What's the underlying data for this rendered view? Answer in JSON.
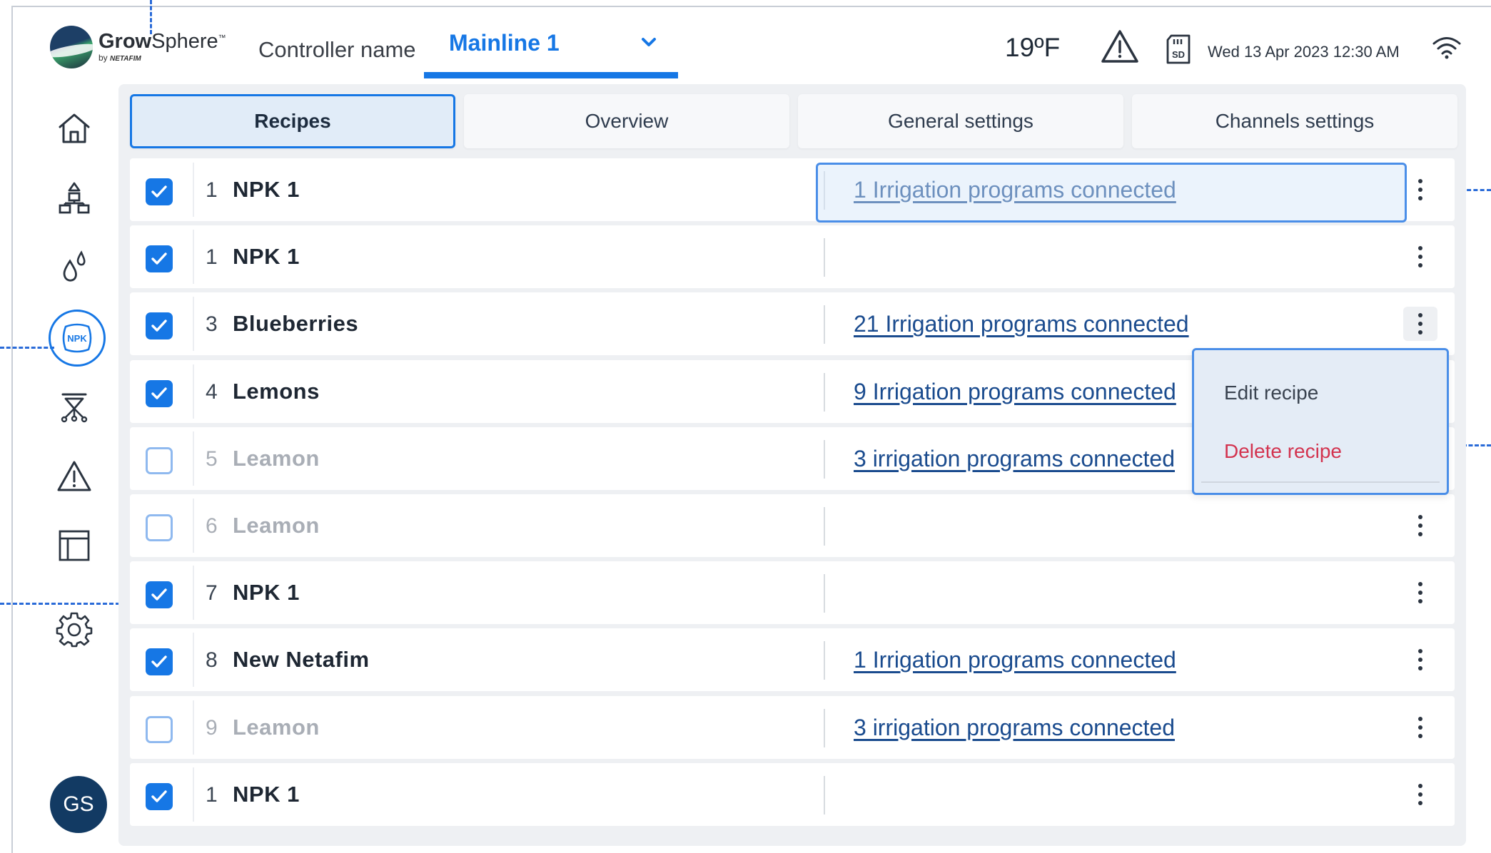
{
  "header": {
    "logo": {
      "brand_bold": "Grow",
      "brand_light": "Sphere",
      "tm": "™",
      "by": "by",
      "maker": "NETAFIM"
    },
    "controller_label": "Controller name",
    "controller_value": "Mainline 1",
    "temperature": "19ºF",
    "datetime": "Wed 13 Apr 2023   12:30 AM",
    "icons": [
      "alert-triangle-icon",
      "sd-card-icon",
      "wifi-icon"
    ]
  },
  "sidebar": {
    "items": [
      {
        "name": "home-icon"
      },
      {
        "name": "hierarchy-icon"
      },
      {
        "name": "water-drops-icon"
      },
      {
        "name": "npk-icon",
        "label": "NPK",
        "active": true
      },
      {
        "name": "sprinkler-icon"
      },
      {
        "name": "alert-icon"
      },
      {
        "name": "table-icon"
      },
      {
        "name": "settings-icon"
      }
    ],
    "avatar_initials": "GS"
  },
  "tabs": [
    {
      "label": "Recipes",
      "active": true
    },
    {
      "label": "Overview",
      "active": false
    },
    {
      "label": "General settings",
      "active": false
    },
    {
      "label": "Channels settings",
      "active": false
    }
  ],
  "rows": [
    {
      "checked": true,
      "num": "1",
      "name": "NPK 1",
      "link": "1 Irrigation programs connected"
    },
    {
      "checked": true,
      "num": "1",
      "name": "NPK 1",
      "link": ""
    },
    {
      "checked": true,
      "num": "3",
      "name": "Blueberries",
      "link": "21 Irrigation programs connected"
    },
    {
      "checked": true,
      "num": "4",
      "name": "Lemons",
      "link": "9 Irrigation programs connected"
    },
    {
      "checked": false,
      "num": "5",
      "name": "Leamon",
      "link": "3 irrigation programs connected"
    },
    {
      "checked": false,
      "num": "6",
      "name": "Leamon",
      "link": ""
    },
    {
      "checked": true,
      "num": "7",
      "name": "NPK 1",
      "link": ""
    },
    {
      "checked": true,
      "num": "8",
      "name": "New Netafim",
      "link": "1 Irrigation programs connected"
    },
    {
      "checked": false,
      "num": "9",
      "name": "Leamon",
      "link": "3 irrigation programs connected"
    },
    {
      "checked": true,
      "num": "1",
      "name": "NPK 1",
      "link": ""
    }
  ],
  "context_menu": {
    "edit": "Edit recipe",
    "delete": "Delete recipe"
  },
  "colors": {
    "accent": "#1677e5",
    "link": "#1a4b8e",
    "danger": "#d3334f",
    "avatar": "#123a63"
  }
}
